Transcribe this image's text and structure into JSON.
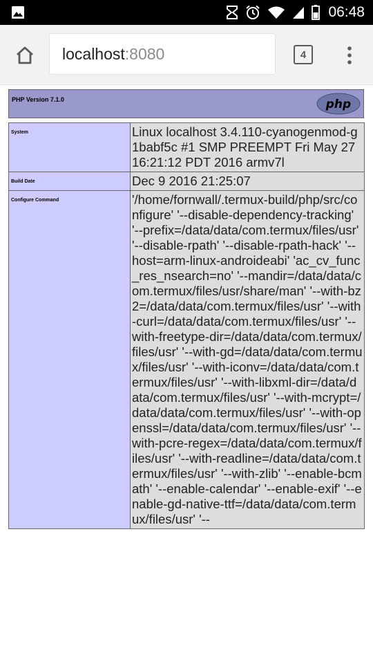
{
  "status_bar": {
    "time": "06:48",
    "icons": [
      "image-icon",
      "data-saver-icon",
      "alarm-icon",
      "wifi-icon",
      "signal-icon",
      "battery-icon"
    ]
  },
  "browser": {
    "url_host": "localhost",
    "url_port": ":8080",
    "tab_count": "4",
    "icons": [
      "home-icon",
      "overflow-menu-icon"
    ]
  },
  "phpinfo": {
    "version_title": "PHP Version 7.1.0",
    "logo_text": "php",
    "rows": [
      {
        "key": "System",
        "value": "Linux localhost 3.4.110-cyanogenmod-g1babf5c #1 SMP PREEMPT Fri May 27 16:21:12 PDT 2016 armv7l"
      },
      {
        "key": "Build Date",
        "value": "Dec 9 2016 21:25:07"
      },
      {
        "key": "Configure Command",
        "value": "'/home/fornwall/.termux-build/php/src/configure' '--disable-dependency-tracking' '--prefix=/data/data/com.termux/files/usr' '--disable-rpath' '--disable-rpath-hack' '--host=arm-linux-androideabi' 'ac_cv_func_res_nsearch=no' '--mandir=/data/data/com.termux/files/usr/share/man' '--with-bz2=/data/data/com.termux/files/usr' '--with-curl=/data/data/com.termux/files/usr' '--with-freetype-dir=/data/data/com.termux/files/usr' '--with-gd=/data/data/com.termux/files/usr' '--with-iconv=/data/data/com.termux/files/usr' '--with-libxml-dir=/data/data/com.termux/files/usr' '--with-mcrypt=/data/data/com.termux/files/usr' '--with-openssl=/data/data/com.termux/files/usr' '--with-pcre-regex=/data/data/com.termux/files/usr' '--with-readline=/data/data/com.termux/files/usr' '--with-zlib' '--enable-bcmath' '--enable-calendar' '--enable-exif' '--enable-gd-native-ttf=/data/data/com.termux/files/usr' '--"
      }
    ]
  }
}
